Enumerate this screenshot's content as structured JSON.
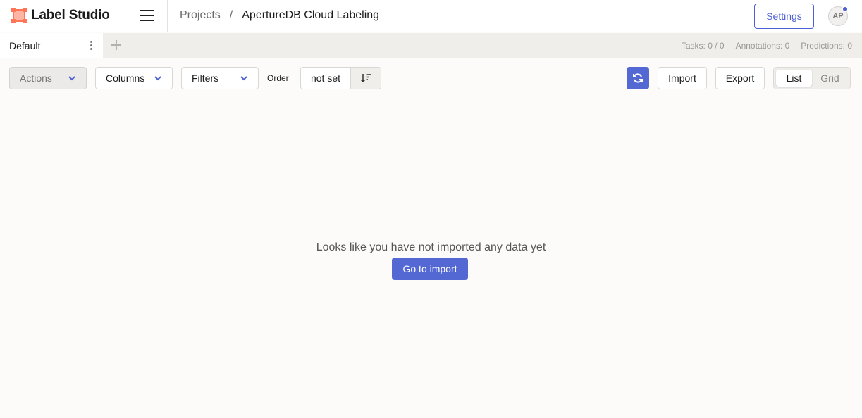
{
  "app": {
    "name": "Label Studio",
    "brand_color": "#ff7557",
    "accent": "#4c5fd5"
  },
  "header": {
    "menu_icon": "hamburger-icon",
    "breadcrumb": {
      "projects": "Projects",
      "separator": "/",
      "project": "ApertureDB Cloud Labeling"
    },
    "settings_label": "Settings",
    "avatar_initials": "AP"
  },
  "tabs": {
    "items": [
      {
        "label": "Default",
        "active": true
      }
    ],
    "stats": {
      "tasks": "Tasks: 0 / 0",
      "annotations": "Annotations: 0",
      "predictions": "Predictions: 0"
    }
  },
  "toolbar": {
    "actions_label": "Actions",
    "columns_label": "Columns",
    "filters_label": "Filters",
    "order_label": "Order",
    "order_value": "not set",
    "import_label": "Import",
    "export_label": "Export",
    "view": {
      "list": "List",
      "grid": "Grid",
      "selected": "List"
    }
  },
  "empty_state": {
    "message": "Looks like you have not imported any data yet",
    "button_label": "Go to import"
  }
}
